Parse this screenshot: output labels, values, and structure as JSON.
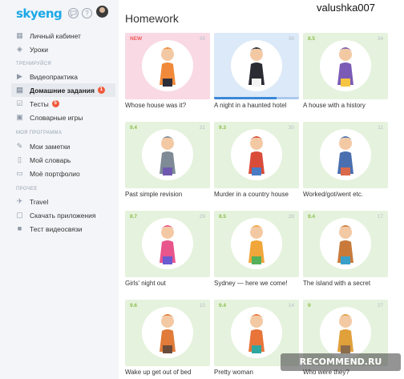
{
  "brand": {
    "logo": "skyeng"
  },
  "header": {
    "username": "valushka007",
    "chat_icon": "chat-icon",
    "help_label": "?"
  },
  "sidebar": {
    "items_top": [
      {
        "label": "Личный кабинет",
        "icon": "dashboard-icon"
      },
      {
        "label": "Уроки",
        "icon": "layers-icon"
      }
    ],
    "section_train": "ТРЕНИРУЙСЯ",
    "items_train": [
      {
        "label": "Видеопрактика",
        "icon": "play-icon"
      },
      {
        "label": "Домашние задания",
        "icon": "book-icon",
        "badge": "1",
        "active": true
      },
      {
        "label": "Тесты",
        "icon": "checkbox-icon",
        "badge": "5"
      },
      {
        "label": "Словарные игры",
        "icon": "game-icon"
      }
    ],
    "section_program": "МОЯ ПРОГРАММА",
    "items_program": [
      {
        "label": "Мои заметки",
        "icon": "pen-icon"
      },
      {
        "label": "Мой словарь",
        "icon": "dictionary-icon"
      },
      {
        "label": "Моё портфолио",
        "icon": "portfolio-icon"
      }
    ],
    "section_other": "ПРОЧЕЕ",
    "items_other": [
      {
        "label": "Travel",
        "icon": "plane-icon"
      },
      {
        "label": "Скачать приложения",
        "icon": "download-icon"
      },
      {
        "label": "Тест видеосвязи",
        "icon": "camera-icon"
      }
    ]
  },
  "main": {
    "title": "Homework",
    "cards": [
      {
        "score": "NEW",
        "count": "35",
        "caption": "Whose house was it?",
        "bg": "#f9d9e4"
      },
      {
        "score": "",
        "count": "36",
        "caption": "A night in a haunted hotel",
        "bg": "#dce9f8",
        "progress": 0.74
      },
      {
        "score": "8.5",
        "count": "34",
        "caption": "A house with a history",
        "bg": "#e5f2dd"
      },
      {
        "score": "9.4",
        "count": "31",
        "caption": "Past simple revision",
        "bg": "#e5f2dd"
      },
      {
        "score": "9.3",
        "count": "30",
        "caption": "Murder in a country house",
        "bg": "#e5f2dd"
      },
      {
        "score": "",
        "count": "11",
        "caption": "Worked/got/went etc.",
        "bg": "#e5f2dd"
      },
      {
        "score": "8.7",
        "count": "29",
        "caption": "Girls' night out",
        "bg": "#e5f2dd"
      },
      {
        "score": "8.5",
        "count": "28",
        "caption": "Sydney — here we come!",
        "bg": "#e5f2dd"
      },
      {
        "score": "9.4",
        "count": "17",
        "caption": "The island with a secret",
        "bg": "#e5f2dd"
      },
      {
        "score": "9.6",
        "count": "15",
        "caption": "Wake up get out of bed",
        "bg": "#e5f2dd"
      },
      {
        "score": "9.4",
        "count": "14",
        "caption": "Pretty woman",
        "bg": "#e5f2dd"
      },
      {
        "score": "9",
        "count": "27",
        "caption": "Who were they?",
        "bg": "#e5f2dd"
      }
    ]
  },
  "watermark": {
    "text": "RECOMMEND.RU"
  }
}
